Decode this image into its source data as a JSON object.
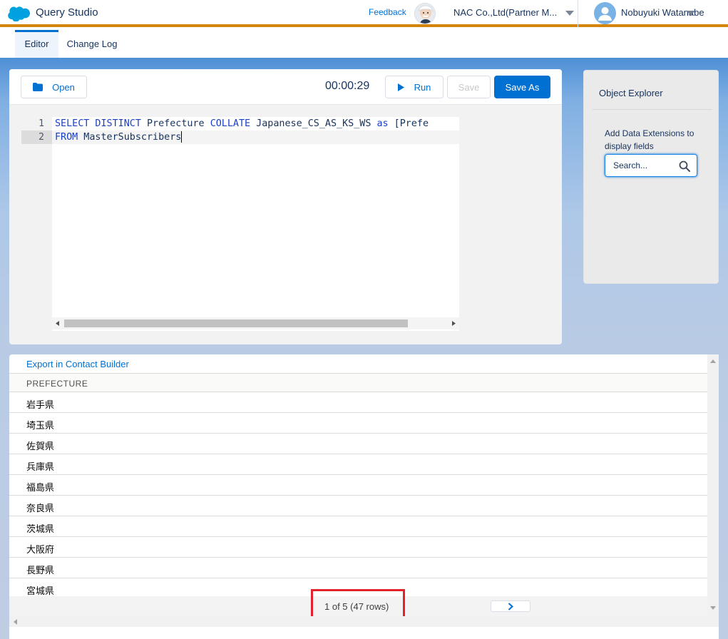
{
  "header": {
    "app_title": "Query Studio",
    "feedback_label": "Feedback",
    "org_name": "NAC Co.,Ltd(Partner M...",
    "user_name": "Nobuyuki Watanabe",
    "accent_color": "#d5860a",
    "logo_icon": "salesforce-cloud-icon"
  },
  "tabs": [
    {
      "label": "Editor",
      "active": true
    },
    {
      "label": "Change Log",
      "active": false
    }
  ],
  "editor": {
    "toolbar": {
      "open_label": "Open",
      "timer": "00:00:29",
      "run_label": "Run",
      "save_label": "Save",
      "save_as_label": "Save As"
    },
    "line_numbers": [
      "1",
      "2"
    ],
    "code": {
      "line1": {
        "kw1": "SELECT DISTINCT",
        "t1": " Prefecture ",
        "kw2": "COLLATE",
        "t2": " Japanese_CS_AS_KS_WS ",
        "kw3": "as",
        "t3": " [Prefe"
      },
      "line2": {
        "kw1": "FROM",
        "t1": " MasterSubscribers"
      }
    }
  },
  "object_explorer": {
    "title": "Object Explorer",
    "hint": "Add Data Extensions to display fields",
    "search_placeholder": "Search..."
  },
  "results": {
    "export_label": "Export in Contact Builder",
    "column_header": "PREFECTURE",
    "rows": [
      "岩手県",
      "埼玉県",
      "佐賀県",
      "兵庫県",
      "福島県",
      "奈良県",
      "茨城県",
      "大阪府",
      "長野県",
      "宮城県"
    ],
    "pagination": "1 of 5 (47 rows)"
  }
}
